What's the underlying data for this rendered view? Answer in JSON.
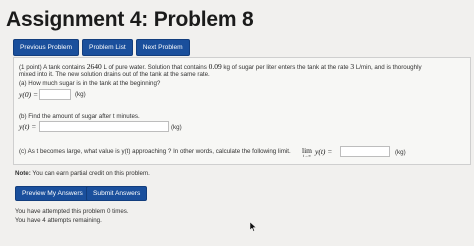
{
  "page": {
    "title": "Assignment 4: Problem 8"
  },
  "nav": {
    "prev": "Previous Problem",
    "list": "Problem List",
    "next": "Next Problem"
  },
  "problem": {
    "line1_a": "(1 point) A tank contains",
    "volume": "2640",
    "line1_b": "L of pure water. Solution that contains",
    "concentration": "0.09",
    "line1_c": "kg of sugar per liter enters the tank at the rate",
    "rate": "3",
    "line1_d": "L/min, and is thoroughly",
    "line2": "mixed into it. The new solution drains out of the tank at the same rate.",
    "part_a": "(a) How much sugar is in the tank at the beginning?",
    "y0_label": "y(0) =",
    "unit_kg": "(kg)",
    "part_b": "(b) Find the amount of sugar after t minutes.",
    "yt_label": "y(t) =",
    "part_c": "(c) As t becomes large, what value is y(t) approaching ? In other words, calculate the following limit.",
    "lim_word": "lim",
    "lim_sub": "t→∞",
    "lim_expr": "y(t) =",
    "answers": {
      "y0": "",
      "yt": "",
      "limit": ""
    }
  },
  "note": {
    "label": "Note:",
    "text": "You can earn partial credit on this problem."
  },
  "buttons": {
    "preview": "Preview My Answers",
    "submit": "Submit Answers"
  },
  "status": {
    "attempted": "You have attempted this problem 0 times.",
    "remaining": "You have 4 attempts remaining."
  }
}
